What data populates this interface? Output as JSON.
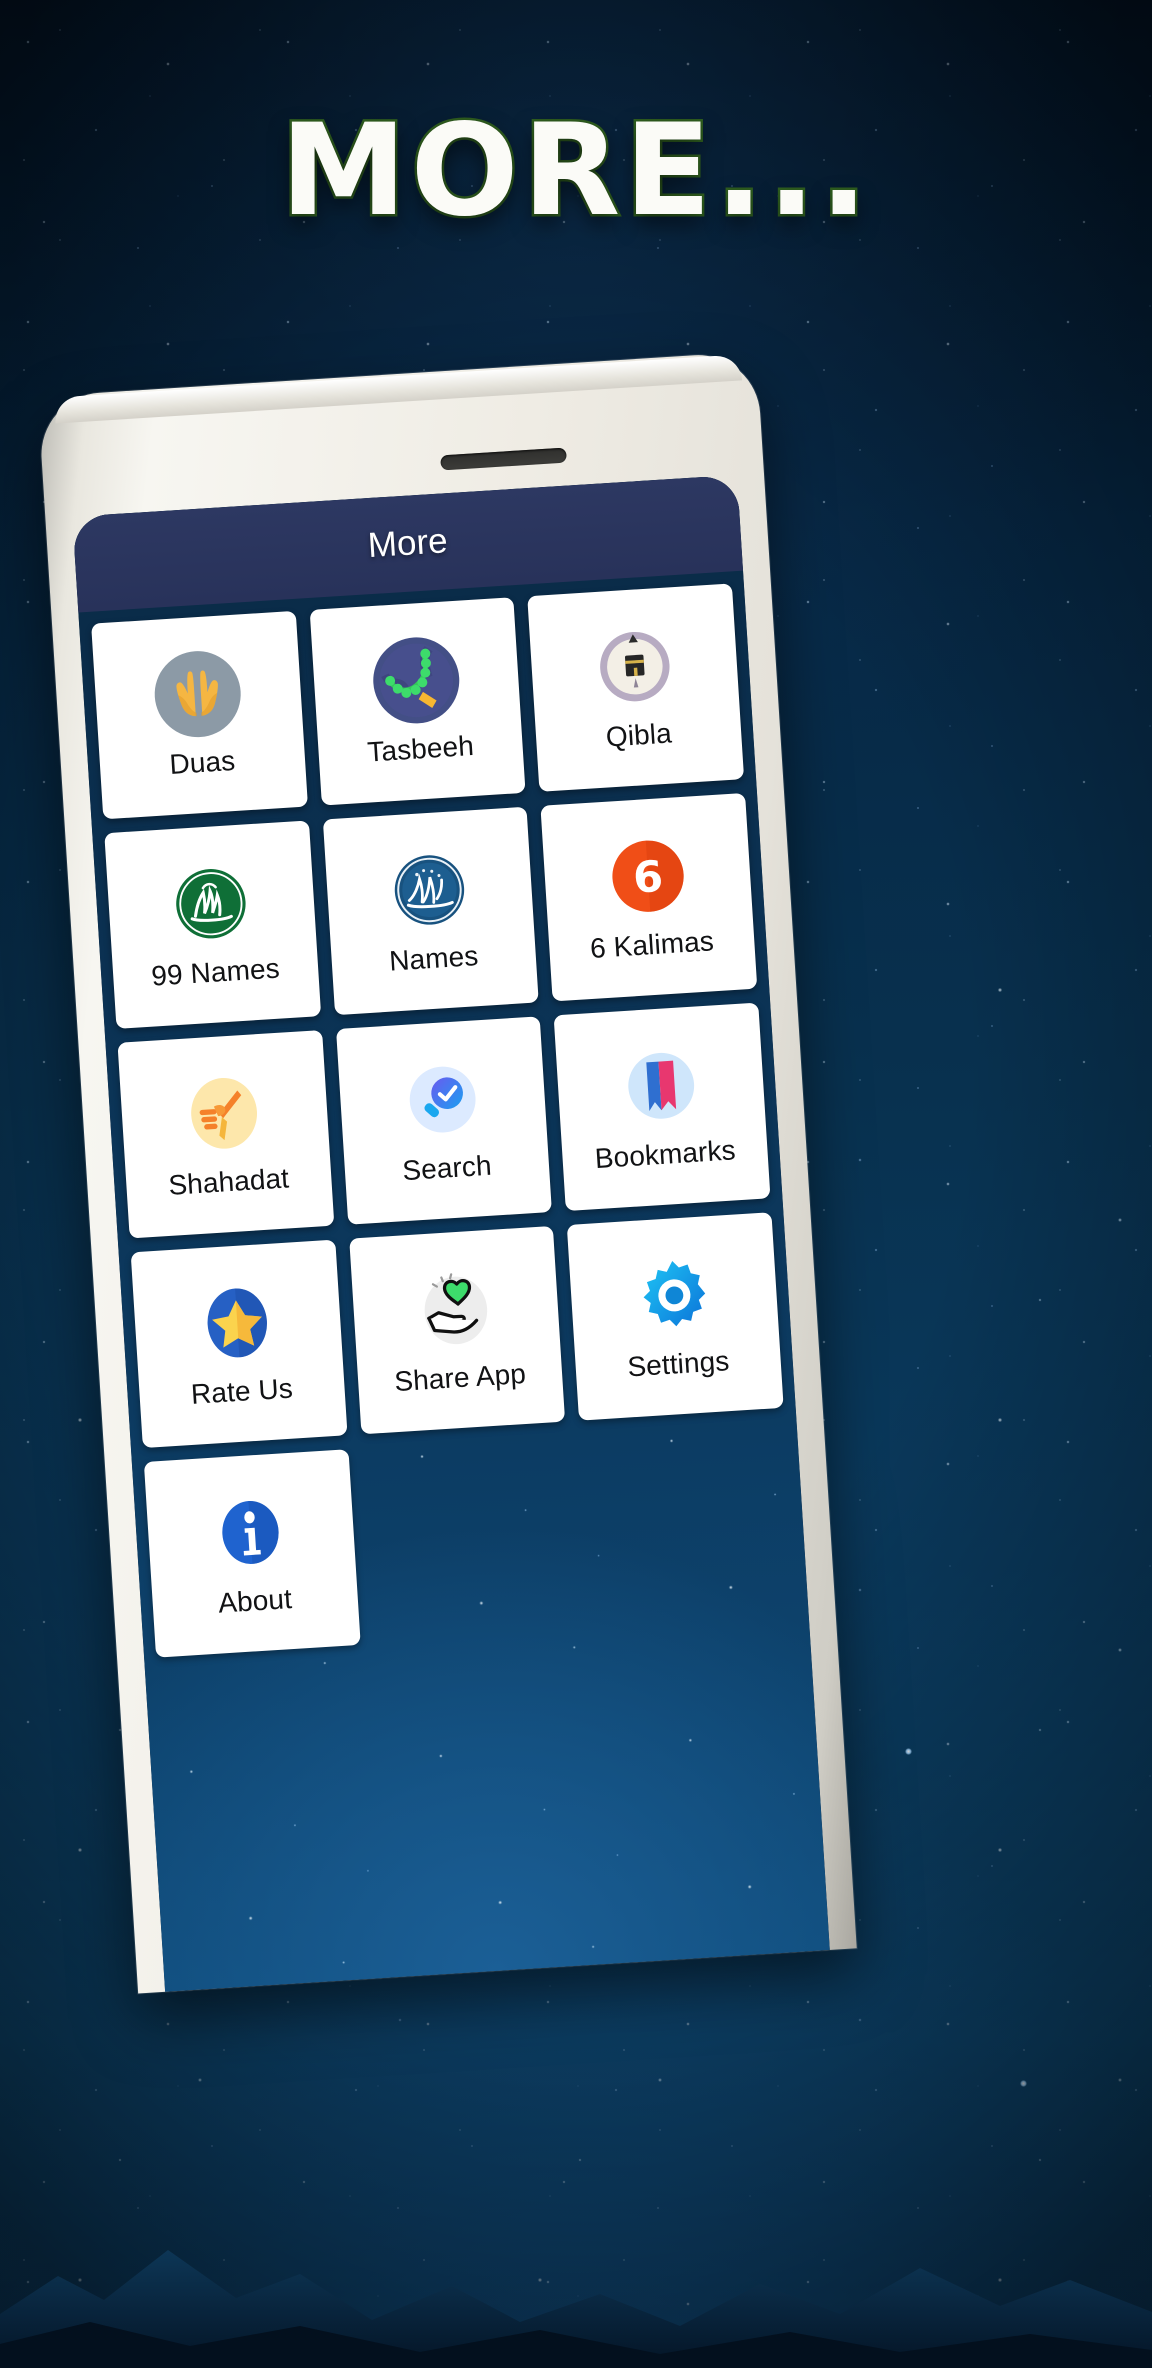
{
  "promo": {
    "headline": "MORE...",
    "headline_fill": "#fbfbf7",
    "headline_outline": "#2f5e1f",
    "background_theme": "starry-night-sky-with-mountains"
  },
  "device": {
    "frame_color": "#efece4",
    "screen_background": "#0c3a60"
  },
  "app": {
    "appbar": {
      "title": "More",
      "background": "#2d3862",
      "text_color": "#ffffff"
    },
    "grid": {
      "columns": 3,
      "tile_background": "#ffffff",
      "label_color": "#111214",
      "items": [
        {
          "label": "Duas",
          "icon": "praying-hands-icon",
          "badge_color": "#8c9aa6"
        },
        {
          "label": "Tasbeeh",
          "icon": "prayer-beads-icon",
          "badge_color": "#434f86"
        },
        {
          "label": "Qibla",
          "icon": "qibla-compass-icon",
          "badge_color": "#b3a9bd"
        },
        {
          "label": "99 Names",
          "icon": "allah-calligraphy-icon",
          "badge_color": "#12793c"
        },
        {
          "label": "Names",
          "icon": "muhammad-calligraphy-icon",
          "badge_color": "#1a5b91"
        },
        {
          "label": "6 Kalimas",
          "icon": "number-six-icon",
          "badge_color": "#f04e17"
        },
        {
          "label": "Shahadat",
          "icon": "shahada-finger-icon",
          "badge_color": "#fde9b0"
        },
        {
          "label": "Search",
          "icon": "search-check-icon",
          "badge_color": "#dceaff"
        },
        {
          "label": "Bookmarks",
          "icon": "bookmark-icon",
          "badge_color": "#cfe6fb"
        },
        {
          "label": "Rate Us",
          "icon": "star-rating-icon",
          "badge_color": "#2660c4"
        },
        {
          "label": "Share App",
          "icon": "share-heart-hand-icon",
          "badge_color": "#ebebeb"
        },
        {
          "label": "Settings",
          "icon": "gear-icon",
          "badge_color": "#1aa7e8"
        },
        {
          "label": "About",
          "icon": "info-icon",
          "badge_color": "#1f63cf"
        }
      ]
    }
  }
}
